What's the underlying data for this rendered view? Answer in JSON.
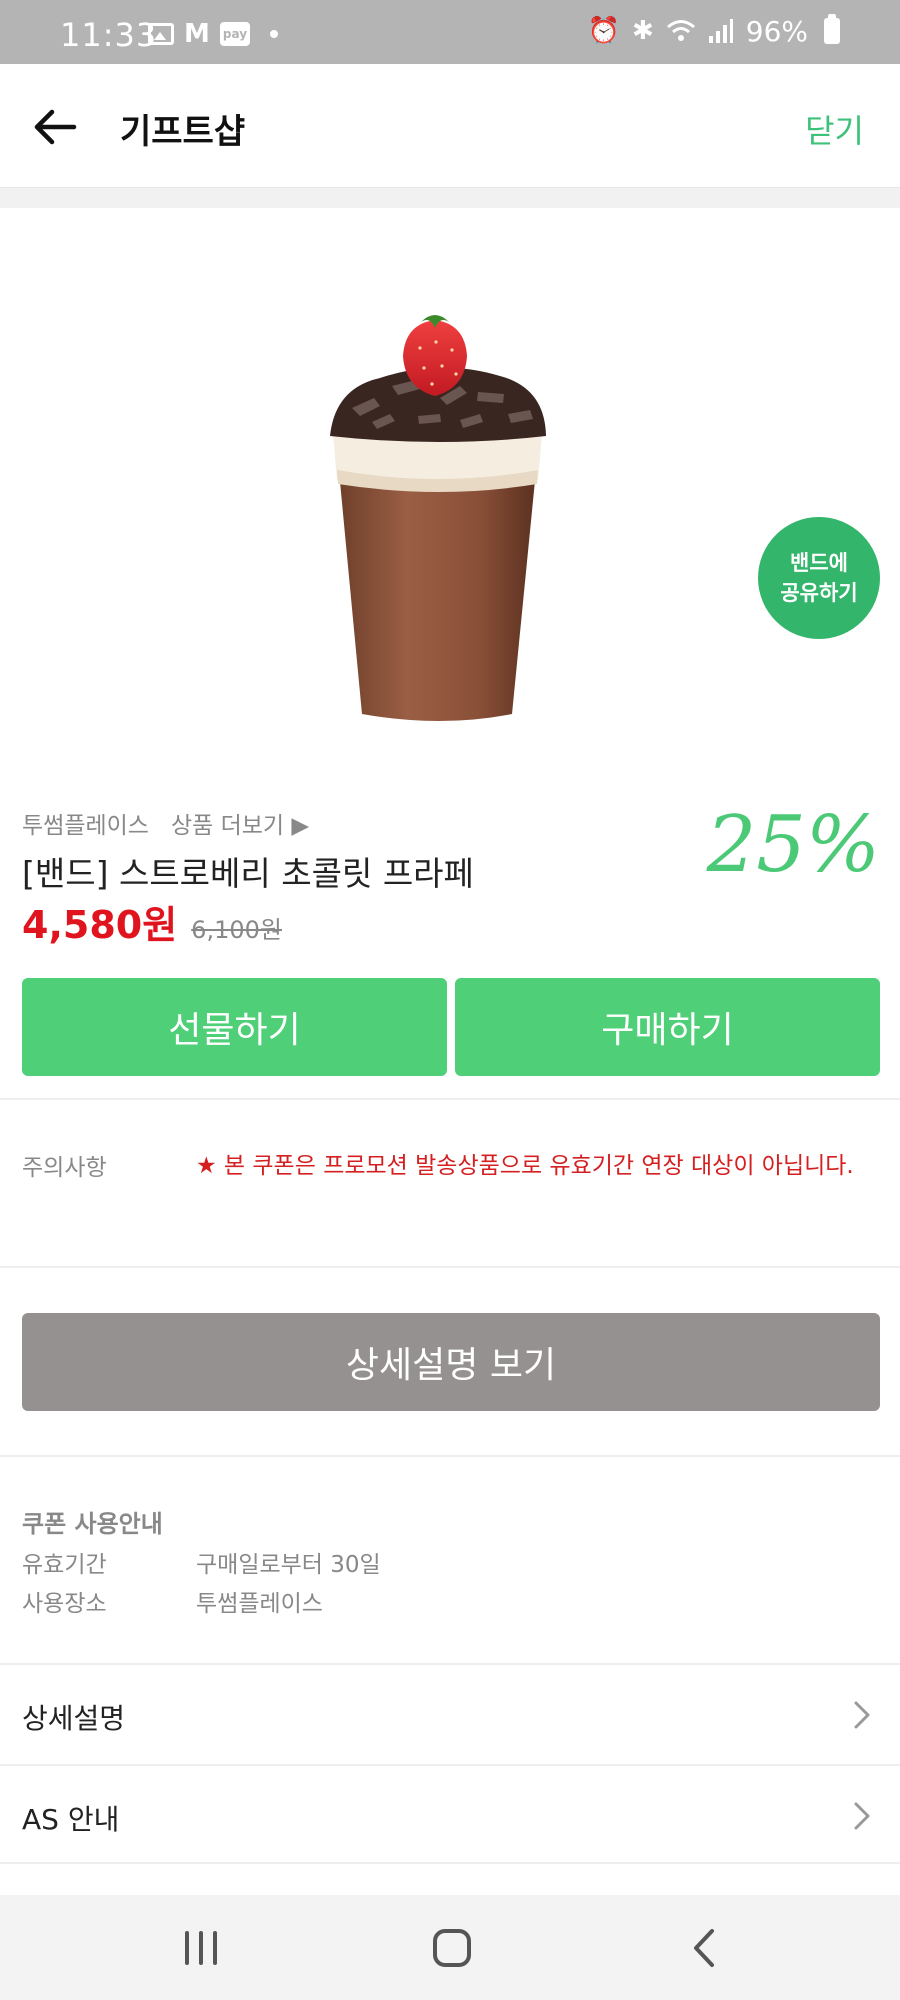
{
  "status_bar": {
    "time": "11:33",
    "left_icons": [
      "gallery-icon",
      "gmail-icon",
      "pay-icon",
      "dot-icon"
    ],
    "pay_label": "pay",
    "battery": "96%",
    "right_icons": [
      "alarm-icon",
      "bluetooth-icon",
      "wifi-icon",
      "signal-icon",
      "battery-icon"
    ]
  },
  "header": {
    "title": "기프트샵",
    "close_label": "닫기",
    "back_icon": "arrow-left-icon"
  },
  "product": {
    "image_alt": "strawberry chocolate frappe",
    "share_line1": "밴드에",
    "share_line2": "공유하기",
    "brand": "투썸플레이스",
    "more_link": "상품 더보기 ▶",
    "name": "[밴드] 스트로베리 초콜릿 프라페",
    "discount": "25%",
    "price": "4,580원",
    "original_price": "6,100원"
  },
  "actions": {
    "gift_label": "선물하기",
    "buy_label": "구매하기"
  },
  "caution": {
    "label": "주의사항",
    "text": "★ 본 쿠폰은 프로모션 발송상품으로 유효기간 연장 대상이 아닙니다."
  },
  "detail_button": "상세설명 보기",
  "coupon_info": {
    "title": "쿠폰 사용안내",
    "rows": [
      {
        "key": "유효기간",
        "value": "구매일로부터 30일"
      },
      {
        "key": "사용장소",
        "value": "투썸플레이스"
      }
    ]
  },
  "list": {
    "items": [
      {
        "label": "상세설명"
      },
      {
        "label": "AS 안내"
      }
    ]
  },
  "colors": {
    "accent_green": "#4ecf78",
    "price_red": "#e0141e",
    "status_bar": "#b4b4b4",
    "detail_button": "#949190"
  }
}
